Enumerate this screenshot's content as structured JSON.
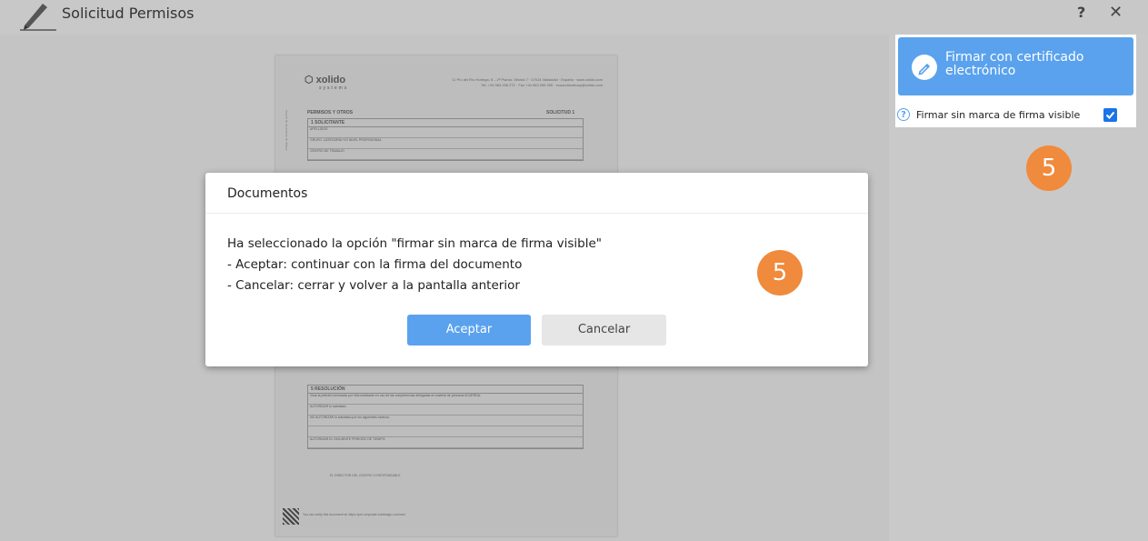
{
  "window": {
    "title": "Solicitud Permisos",
    "help_label": "?",
    "close_label": "✕"
  },
  "document": {
    "logo_text": "xolido",
    "logo_sub": "systems",
    "address_line1": "C/ Pío del Río Hortega, 8 – 2ª Planta, Oficina 7 · 47014 Valladolid · España · www.xolido.com",
    "address_line2": "Tel: +34 983 298 272 · Fax +34 983 298 250 · ecoarchivohosp@xolido.com",
    "header_left": "PERMISOS Y OTROS",
    "header_right": "SOLICITUD 1",
    "section1": "1  SOLICITANTE",
    "section1_rows": [
      "APELLIDOS",
      "GRUPO, CATEGORÍA Y/O NIVEL PROFESIONAL",
      "CENTRO DE TRABAJO"
    ],
    "section5": "5  RESOLUCIÓN",
    "section5_rows": [
      "Vista la petición formulada por el/la solicitante en uso de las competencias delegadas en materia de personal ACUERDA:",
      "AUTORIZAR lo solicitado.",
      "NO AUTORIZAR lo solicitado por los siguientes motivos:",
      "",
      "AUTORIZAR EL SIGUIENTE PERIODO DE TIEMPO:"
    ],
    "signature_text": "EL DIRECTOR DEL CENTRO O RESPONSABLE",
    "footer_text": "You can verify this document at: https://pre.corporate.xolidosign.com/csv/",
    "side_text": "Código de verificación de la firma"
  },
  "sign_panel": {
    "sign_button_label": "Firmar con certificado electrónico",
    "option_label": "Firmar sin marca de firma visible",
    "option_checked": true
  },
  "badges": {
    "panel_badge": "5",
    "modal_badge": "5"
  },
  "modal": {
    "title": "Documentos",
    "line1": "Ha seleccionado la opción \"firmar sin marca de firma visible\"",
    "line2": "- Aceptar: continuar con la firma del documento",
    "line3": "- Cancelar: cerrar y volver a la pantalla anterior",
    "accept_label": "Aceptar",
    "cancel_label": "Cancelar"
  },
  "colors": {
    "accent": "#5aa2ee",
    "badge": "#f08a3c",
    "checkbox": "#1a73e8"
  }
}
